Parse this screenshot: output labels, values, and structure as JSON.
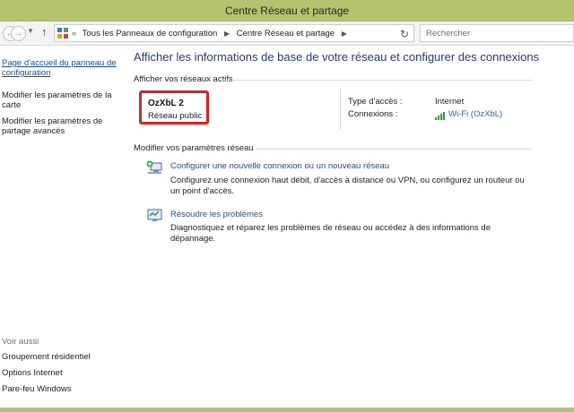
{
  "window": {
    "title": "Centre Réseau et partage"
  },
  "address": {
    "crumb_root": "Tous les Panneaux de configuration",
    "crumb_current": "Centre Réseau et partage",
    "search_placeholder": "Rechercher"
  },
  "sidebar": {
    "home_link": "Page d'accueil du panneau de configuration",
    "links": [
      "Modifier les paramètres de la carte",
      "Modifier les paramètres de partage avancés"
    ],
    "see_also_heading": "Voir aussi",
    "see_also": [
      "Groupement résidentiel",
      "Options Internet",
      "Pare-feu Windows"
    ]
  },
  "main": {
    "title": "Afficher les informations de base de votre réseau et configurer des connexions",
    "active_heading": "Afficher vos réseaux actifs",
    "network": {
      "name": "OzXbL 2",
      "type": "Réseau public",
      "access_label": "Type d'accès :",
      "access_value": "Internet",
      "connections_label": "Connexions :",
      "connection_value": "Wi-Fi (OzXbL)"
    },
    "modify_heading": "Modifier vos paramètres réseau",
    "tasks": [
      {
        "title": "Configurer une nouvelle connexion ou un nouveau réseau",
        "desc": "Configurez une connexion haut débit, d'accès à distance ou VPN, ou configurez un routeur ou un point d'accès."
      },
      {
        "title": "Résoudre les problèmes",
        "desc": "Diagnostiquez et réparez les problèmes de réseau ou accédez à des informations de dépannage."
      }
    ]
  },
  "colors": {
    "titlebar": "#b3c36e",
    "link": "#1a4fa3",
    "title_blue": "#1e3b8a",
    "highlight": "#e02020"
  }
}
